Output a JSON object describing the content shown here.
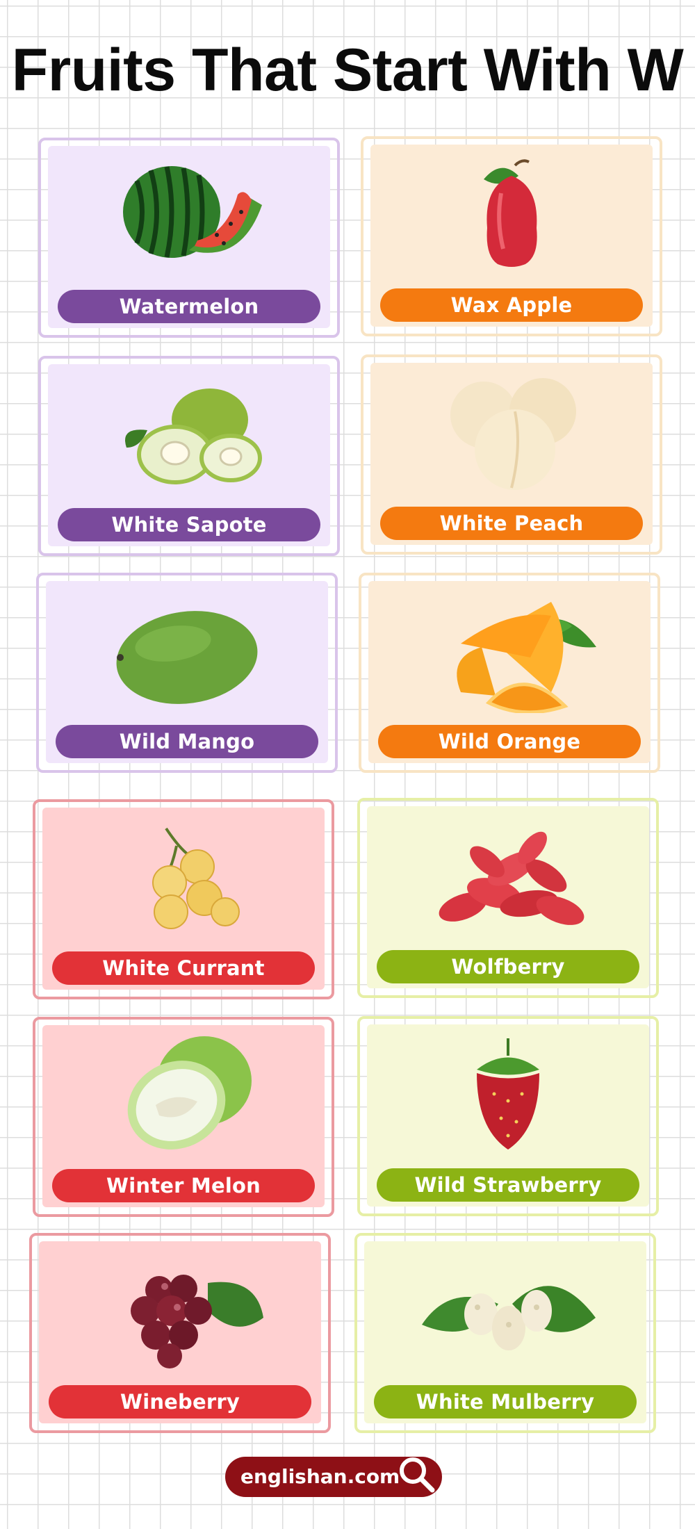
{
  "title": "Fruits That Start With W",
  "cards": [
    {
      "label": "Watermelon",
      "icon": "watermelon-icon"
    },
    {
      "label": "Wax Apple",
      "icon": "wax-apple-icon"
    },
    {
      "label": "White Sapote",
      "icon": "white-sapote-icon"
    },
    {
      "label": "White Peach",
      "icon": "white-peach-icon"
    },
    {
      "label": "Wild Mango",
      "icon": "wild-mango-icon"
    },
    {
      "label": "Wild Orange",
      "icon": "wild-orange-icon"
    },
    {
      "label": "White Currant",
      "icon": "white-currant-icon"
    },
    {
      "label": "Wolfberry",
      "icon": "wolfberry-icon"
    },
    {
      "label": "Winter Melon",
      "icon": "winter-melon-icon"
    },
    {
      "label": "Wild Strawberry",
      "icon": "wild-strawberry-icon"
    },
    {
      "label": "Wineberry",
      "icon": "wineberry-icon"
    },
    {
      "label": "White Mulberry",
      "icon": "white-mulberry-icon"
    }
  ],
  "footer": {
    "brand": "englishan.com",
    "icon": "search-icon"
  },
  "colors": {
    "purple": "#7a4a9c",
    "orange": "#f47a10",
    "red": "#e23237",
    "green": "#8cb314",
    "brand": "#8e1016"
  }
}
